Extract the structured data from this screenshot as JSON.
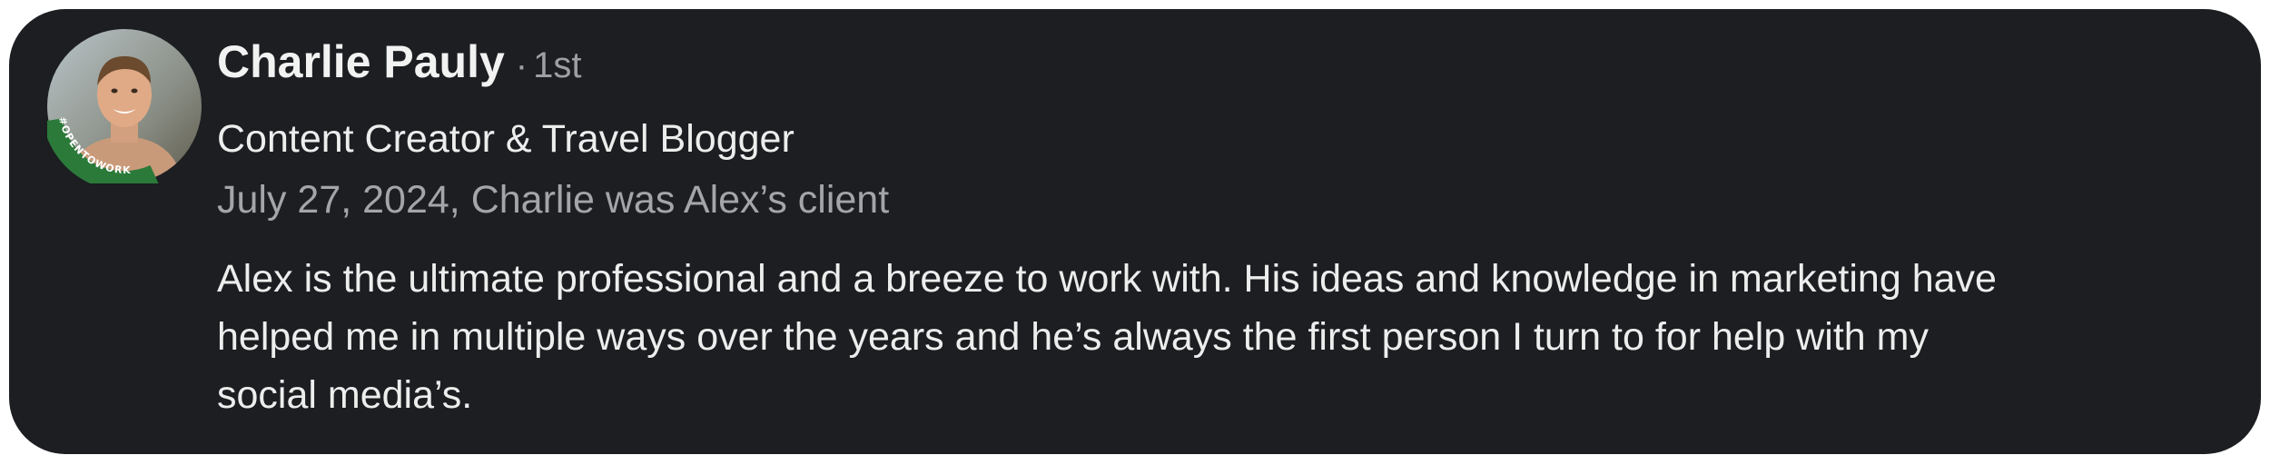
{
  "recommendation": {
    "author": {
      "name": "Charlie Pauly",
      "separator": "·",
      "connection_degree": "1st",
      "headline": "Content Creator & Travel Blogger",
      "avatar_badge_text": "#OPENTOWORK",
      "avatar_badge_color": "#2b7a3a"
    },
    "relationship": "July 27, 2024, Charlie was Alex’s client",
    "text_lines": [
      "Alex is the ultimate professional and a breeze to work with. His ideas and knowledge in marketing have",
      "helped me in multiple ways over the years and he’s always the first person I turn to for help with my",
      "social media’s."
    ]
  },
  "colors": {
    "card_background": "#1c1e21",
    "primary_text": "#ededed",
    "secondary_text": "#a4a5a8"
  }
}
